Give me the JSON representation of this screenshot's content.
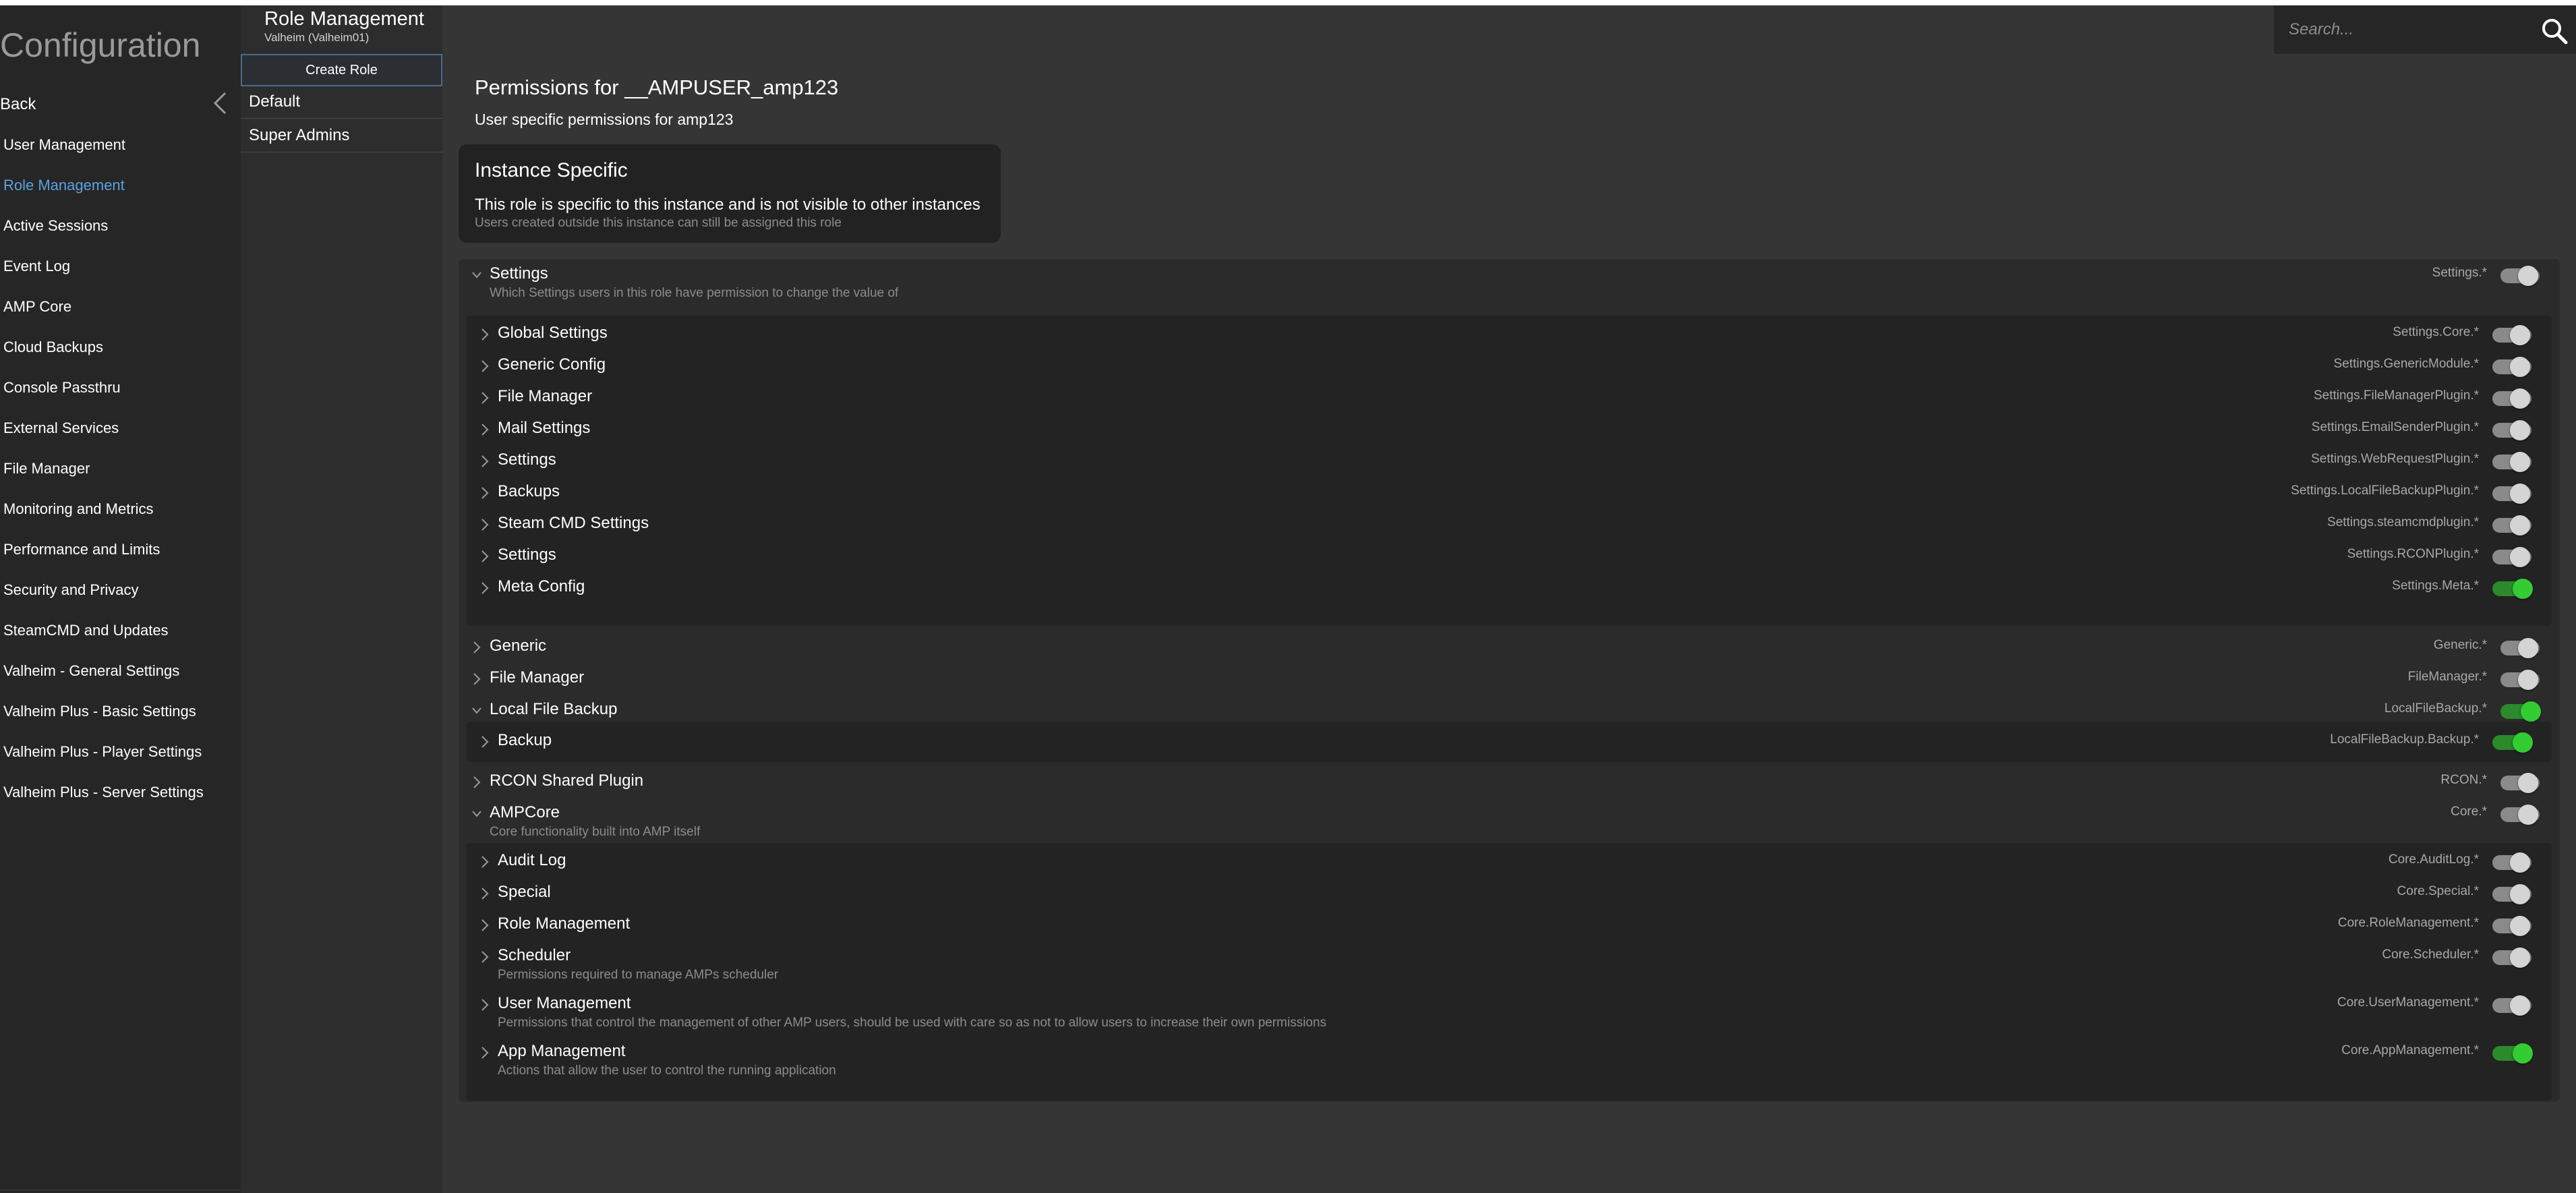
{
  "sidebar": {
    "title": "Configuration",
    "back": "Back",
    "items": [
      {
        "label": "User Management",
        "active": false
      },
      {
        "label": "Role Management",
        "active": true
      },
      {
        "label": "Active Sessions",
        "active": false
      },
      {
        "label": "Event Log",
        "active": false
      },
      {
        "label": "AMP Core",
        "active": false
      },
      {
        "label": "Cloud Backups",
        "active": false
      },
      {
        "label": "Console Passthru",
        "active": false
      },
      {
        "label": "External Services",
        "active": false
      },
      {
        "label": "File Manager",
        "active": false
      },
      {
        "label": "Monitoring and Metrics",
        "active": false
      },
      {
        "label": "Performance and Limits",
        "active": false
      },
      {
        "label": "Security and Privacy",
        "active": false
      },
      {
        "label": "SteamCMD and Updates",
        "active": false
      },
      {
        "label": "Valheim - General Settings",
        "active": false
      },
      {
        "label": "Valheim Plus - Basic Settings",
        "active": false
      },
      {
        "label": "Valheim Plus - Player Settings",
        "active": false
      },
      {
        "label": "Valheim Plus - Server Settings",
        "active": false
      }
    ]
  },
  "roles_panel": {
    "title": "Role Management",
    "subtitle": "Valheim (Valheim01)",
    "create_label": "Create Role",
    "roles": [
      "Default",
      "Super Admins"
    ]
  },
  "search": {
    "placeholder": "Search..."
  },
  "main": {
    "title": "Permissions for __AMPUSER_amp123",
    "subtitle": "User specific permissions for amp123",
    "notice": {
      "title": "Instance Specific",
      "line1": "This role is specific to this instance and is not visible to other instances",
      "line2": "Users created outside this instance can still be assigned this role"
    },
    "tree": {
      "settings": {
        "label": "Settings",
        "desc": "Which Settings users in this role have permission to change the value of",
        "node": "Settings.*",
        "on": false
      },
      "settings_children": [
        {
          "label": "Global Settings",
          "node": "Settings.Core.*",
          "on": false
        },
        {
          "label": "Generic Config",
          "node": "Settings.GenericModule.*",
          "on": false
        },
        {
          "label": "File Manager",
          "node": "Settings.FileManagerPlugin.*",
          "on": false
        },
        {
          "label": "Mail Settings",
          "node": "Settings.EmailSenderPlugin.*",
          "on": false
        },
        {
          "label": "Settings",
          "node": "Settings.WebRequestPlugin.*",
          "on": false
        },
        {
          "label": "Backups",
          "node": "Settings.LocalFileBackupPlugin.*",
          "on": false
        },
        {
          "label": "Steam CMD Settings",
          "node": "Settings.steamcmdplugin.*",
          "on": false
        },
        {
          "label": "Settings",
          "node": "Settings.RCONPlugin.*",
          "on": false
        },
        {
          "label": "Meta Config",
          "node": "Settings.Meta.*",
          "on": true
        }
      ],
      "generic": {
        "label": "Generic",
        "node": "Generic.*",
        "on": false
      },
      "file_manager": {
        "label": "File Manager",
        "node": "FileManager.*",
        "on": false
      },
      "local_backup": {
        "label": "Local File Backup",
        "node": "LocalFileBackup.*",
        "on": true
      },
      "local_backup_children": [
        {
          "label": "Backup",
          "node": "LocalFileBackup.Backup.*",
          "on": true
        }
      ],
      "rcon": {
        "label": "RCON Shared Plugin",
        "node": "RCON.*",
        "on": false
      },
      "ampcore": {
        "label": "AMPCore",
        "desc": "Core functionality built into AMP itself",
        "node": "Core.*",
        "on": false
      },
      "ampcore_children": [
        {
          "label": "Audit Log",
          "desc": "",
          "node": "Core.AuditLog.*",
          "on": false
        },
        {
          "label": "Special",
          "desc": "",
          "node": "Core.Special.*",
          "on": false
        },
        {
          "label": "Role Management",
          "desc": "",
          "node": "Core.RoleManagement.*",
          "on": false
        },
        {
          "label": "Scheduler",
          "desc": "Permissions required to manage AMPs scheduler",
          "node": "Core.Scheduler.*",
          "on": false
        },
        {
          "label": "User Management",
          "desc": "Permissions that control the management of other AMP users, should be used with care so as not to allow users to increase their own permissions",
          "node": "Core.UserManagement.*",
          "on": false
        },
        {
          "label": "App Management",
          "desc": "Actions that allow the user to control the running application",
          "node": "Core.AppManagement.*",
          "on": true
        }
      ]
    }
  }
}
